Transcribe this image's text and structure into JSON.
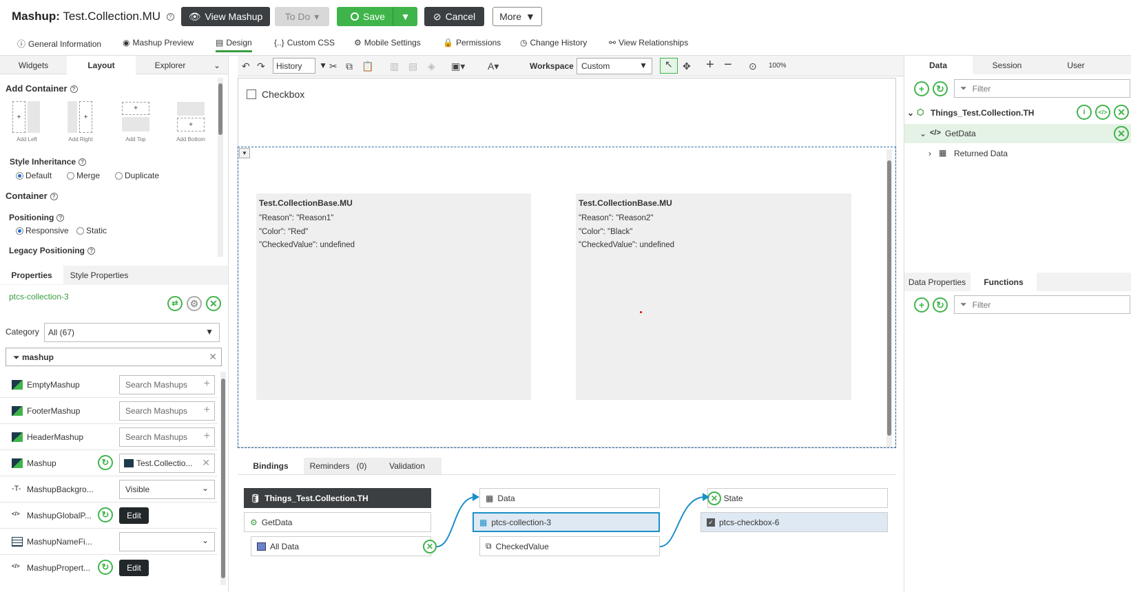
{
  "header": {
    "title_prefix": "Mashup:",
    "title_name": "Test.Collection.MU",
    "view_mashup": "View Mashup",
    "todo": "To Do",
    "save": "Save",
    "cancel": "Cancel",
    "more": "More"
  },
  "nav_tabs": [
    {
      "label": "General Information",
      "icon": "info-icon"
    },
    {
      "label": "Mashup Preview",
      "icon": "eye-icon"
    },
    {
      "label": "Design",
      "icon": "design-icon"
    },
    {
      "label": "Custom CSS",
      "icon": "css-icon"
    },
    {
      "label": "Mobile Settings",
      "icon": "gear-icon"
    },
    {
      "label": "Permissions",
      "icon": "lock-icon"
    },
    {
      "label": "Change History",
      "icon": "clock-icon"
    },
    {
      "label": "View Relationships",
      "icon": "relationships-icon"
    }
  ],
  "left_panel": {
    "tabs": [
      "Widgets",
      "Layout",
      "Explorer"
    ],
    "add_container": "Add Container",
    "container_opts": [
      "Add Left",
      "Add Right",
      "Add Top",
      "Add Bottom"
    ],
    "style_inheritance": "Style Inheritance",
    "style_opts": [
      "Default",
      "Merge",
      "Duplicate"
    ],
    "container": "Container",
    "positioning": "Positioning",
    "positioning_opts": [
      "Responsive",
      "Static"
    ],
    "legacy_positioning": "Legacy Positioning"
  },
  "properties": {
    "tabs": [
      "Properties",
      "Style Properties"
    ],
    "widget_id": "ptcs-collection-3",
    "category_label": "Category",
    "category_value": "All (67)",
    "search_value": "mashup",
    "rows": [
      {
        "label": "EmptyMashup",
        "value": "Search Mashups",
        "icon": "mashup-icon"
      },
      {
        "label": "FooterMashup",
        "value": "Search Mashups",
        "icon": "mashup-icon"
      },
      {
        "label": "HeaderMashup",
        "value": "Search Mashups",
        "icon": "mashup-icon"
      },
      {
        "label": "Mashup",
        "value": "Test.Collectio...",
        "icon": "mashup-icon"
      },
      {
        "label": "MashupBackgro...",
        "value": "Visible",
        "icon": "text-icon"
      },
      {
        "label": "MashupGlobalP...",
        "value": "Edit",
        "icon": "json-icon"
      },
      {
        "label": "MashupNameFi...",
        "value": "",
        "icon": "table-icon"
      },
      {
        "label": "MashupPropert...",
        "value": "Edit",
        "icon": "json-icon"
      }
    ]
  },
  "toolbar": {
    "history": "History",
    "workspace_label": "Workspace",
    "workspace_value": "Custom",
    "zoom": "100%"
  },
  "canvas": {
    "checkbox_label": "Checkbox",
    "items": [
      {
        "title": "Test.CollectionBase.MU",
        "reason": "\"Reason\": \"Reason1\"",
        "color": "\"Color\": \"Red\"",
        "checked": "\"CheckedValue\": undefined"
      },
      {
        "title": "Test.CollectionBase.MU",
        "reason": "\"Reason\": \"Reason2\"",
        "color": "\"Color\": \"Black\"",
        "checked": "\"CheckedValue\": undefined"
      }
    ]
  },
  "bindings": {
    "tabs": [
      "Bindings",
      "Reminders",
      "Validation"
    ],
    "reminders_count": "(0)",
    "source_thing": "Things_Test.Collection.TH",
    "source_service": "GetData",
    "source_data": "All Data",
    "target_data": "Data",
    "target_widget": "ptcs-collection-3",
    "target_checked": "CheckedValue",
    "state_label": "State",
    "checkbox_widget": "ptcs-checkbox-6"
  },
  "right_panel": {
    "tabs": [
      "Data",
      "Session",
      "User"
    ],
    "filter_placeholder": "Filter",
    "thing": "Things_Test.Collection.TH",
    "service": "GetData",
    "returned_data": "Returned Data",
    "bottom_tabs": [
      "Data Properties",
      "Functions"
    ]
  },
  "colors": {
    "accent_green": "#3fb44a",
    "dark_button": "#3b3f42",
    "selection_blue": "#1a8fc9"
  }
}
